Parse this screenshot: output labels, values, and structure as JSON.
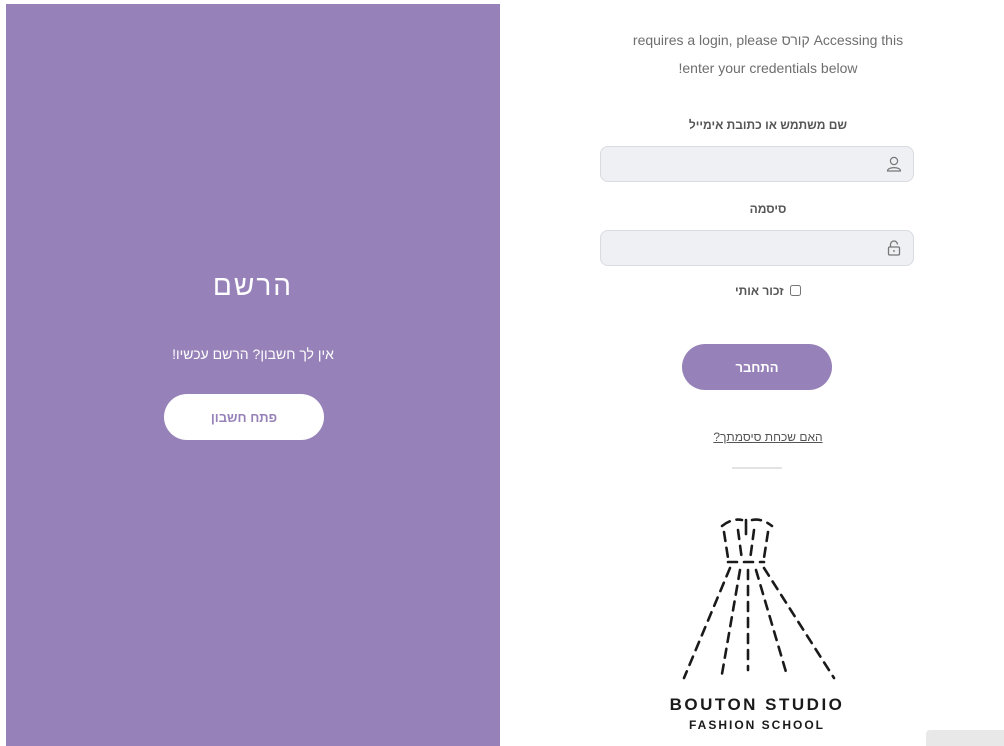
{
  "register": {
    "title": "הרשם",
    "subtitle": "אין לך חשבון? הרשם עכשיו!",
    "button_label": "פתח חשבון"
  },
  "login": {
    "intro_line_1": "requires a login, please קורס Accessing this",
    "intro_line_2": "!enter your credentials below",
    "username_label": "שם משתמש או כתובת אימייל",
    "username_value": "",
    "password_label": "סיסמה",
    "password_value": "",
    "remember_label": "זכור אותי",
    "remember_checked": false,
    "submit_label": "התחבר",
    "forgot_label": "האם שכחת סיסמתך?"
  },
  "logo": {
    "title": "BOUTON STUDIO",
    "subtitle": "FASHION SCHOOL"
  },
  "colors": {
    "accent": "#9682b8",
    "field_bg": "#eef0f4",
    "text": "#555555"
  },
  "icons": {
    "username": "user-icon",
    "password": "lock-icon",
    "logo": "dress-outline-icon"
  }
}
